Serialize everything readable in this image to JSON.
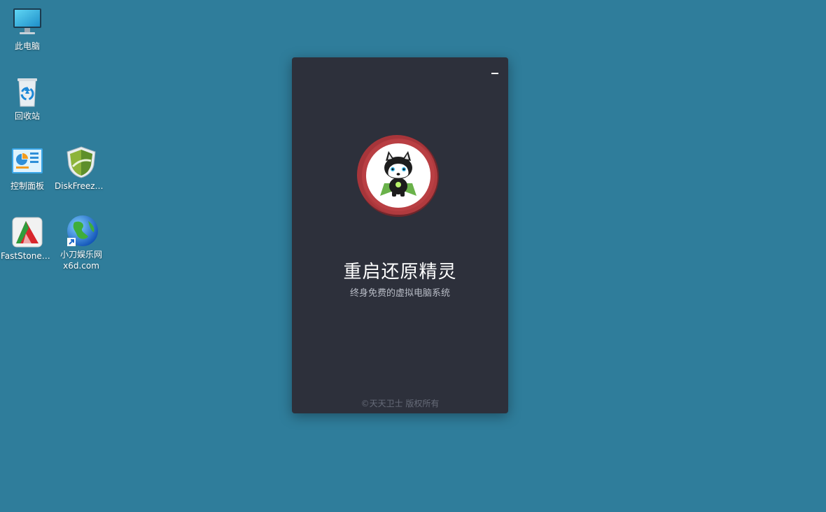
{
  "desktop": {
    "icons": [
      {
        "label": "此电脑",
        "icon": "computer-icon"
      },
      {
        "label": "回收站",
        "icon": "recycle-bin-icon"
      },
      {
        "label": "控制面板",
        "icon": "control-panel-icon"
      },
      {
        "label": "DiskFreeze...",
        "icon": "shield-icon"
      },
      {
        "label": "FastStone_...",
        "icon": "faststone-icon"
      },
      {
        "label": "小刀娱乐网",
        "label2": "x6d.com",
        "icon": "globe-icon"
      }
    ]
  },
  "dialog": {
    "title": "重启还原精灵",
    "subtitle": "终身免费的虚拟电脑系统",
    "copyright": "©天天卫士 版权所有",
    "minimize_icon": "minimize-icon",
    "logo_icon": "husky-mascot-icon"
  },
  "colors": {
    "desktop_bg": "#2f7d9b",
    "dialog_bg": "#2d303b",
    "logo_ring": "#b03a3e"
  }
}
